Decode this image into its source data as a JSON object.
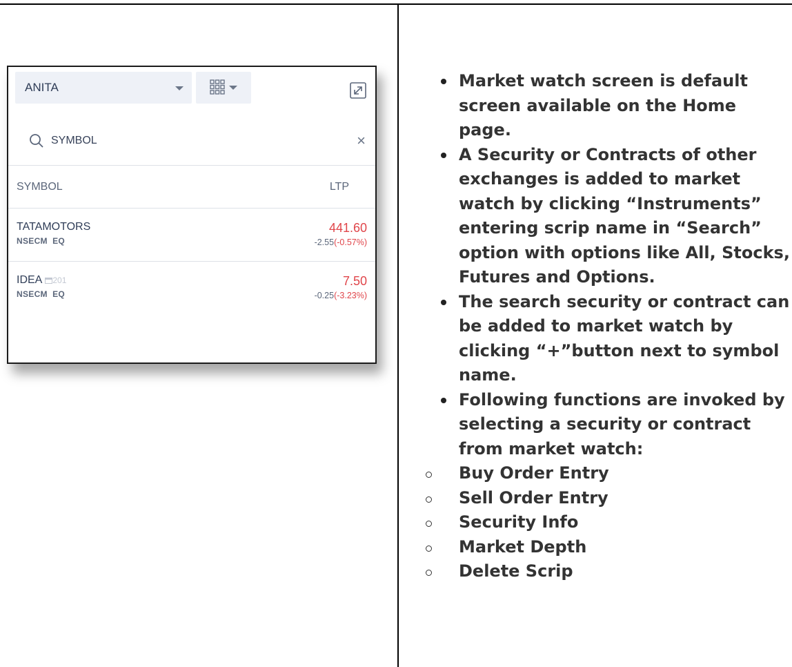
{
  "widget": {
    "watchlist_name": "ANITA",
    "search": {
      "placeholder": "SYMBOL",
      "value": ""
    },
    "columns": {
      "symbol": "SYMBOL",
      "ltp": "LTP"
    },
    "rows": [
      {
        "symbol": "TATAMOTORS",
        "exchange": "NSECM",
        "series": "EQ",
        "ltp": "441.60",
        "change": "-2.55",
        "change_pct": "(-0.57%)",
        "extra": ""
      },
      {
        "symbol": "IDEA",
        "exchange": "NSECM",
        "series": "EQ",
        "ltp": "7.50",
        "change": "-0.25",
        "change_pct": "(-3.23%)",
        "extra": "201"
      }
    ],
    "icons": {
      "dropdown": "chevron-down-icon",
      "view": "grid-icon",
      "expand": "expand-icon",
      "search": "search-icon",
      "clear": "close-icon",
      "calendar": "calendar-icon"
    },
    "colors": {
      "negative": "#e0454a",
      "header_bg": "#eef1f7",
      "text": "#2f3d57"
    }
  },
  "notes": {
    "bullets": [
      "Market watch screen is default screen available on the Home page.",
      "A Security or Contracts of other exchanges is added to market watch by clicking “Instruments” entering scrip name in “Search” option with options like All, Stocks, Futures and Options.",
      "The search security or contract can be added to market watch by clicking “+”button next to symbol name.",
      "Following functions are invoked by selecting a security or contract from market watch:"
    ],
    "functions": [
      "Buy Order Entry",
      "Sell Order Entry",
      "Security Info",
      "Market Depth",
      "Delete Scrip"
    ]
  }
}
